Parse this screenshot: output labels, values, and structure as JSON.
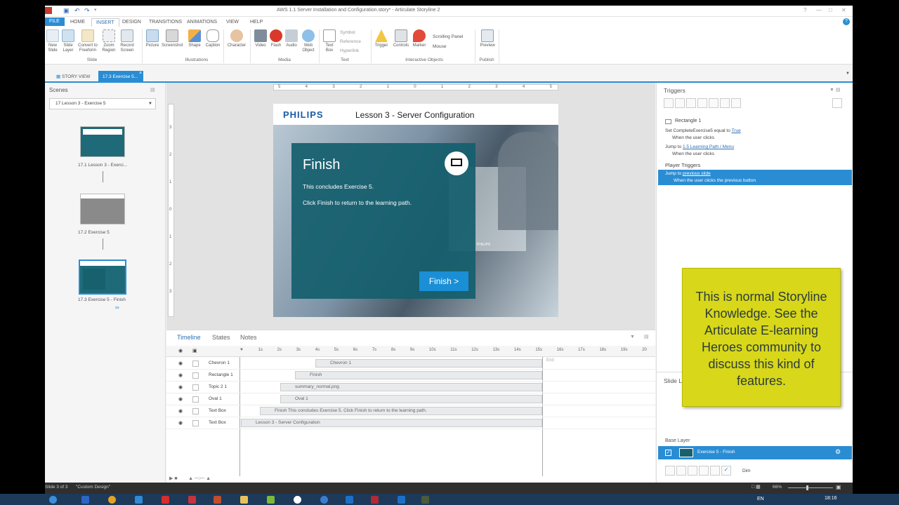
{
  "window": {
    "title": "AWS 1.1 Server Installation and Configuration.story* - Articulate Storyline 2"
  },
  "menu": [
    "FILE",
    "HOME",
    "INSERT",
    "DESIGN",
    "TRANSITIONS",
    "ANIMATIONS",
    "VIEW",
    "HELP"
  ],
  "ribbon": {
    "slide": {
      "group": "Slide",
      "buttons": [
        "New\nSlide",
        "Slide\nLayer",
        "Convert to\nFreeform",
        "Zoom\nRegion",
        "Record\nScreen"
      ]
    },
    "illustrations": {
      "group": "Illustrations",
      "buttons": [
        "Picture",
        "Screenshot",
        "Shape",
        "Caption"
      ]
    },
    "character": {
      "button": "Character"
    },
    "media": {
      "group": "Media",
      "buttons": [
        "Video",
        "Flash",
        "Audio",
        "Web\nObject"
      ]
    },
    "text": {
      "group": "Text",
      "buttons": [
        "Text\nBox"
      ],
      "small": [
        "Symbol",
        "Reference",
        "Hyperlink"
      ]
    },
    "interactive": {
      "group": "Interactive Objects",
      "buttons": [
        "Trigger",
        "Controls",
        "Marker"
      ],
      "small": [
        "Scrolling Panel",
        "Mouse"
      ]
    },
    "publish": {
      "group": "Publish",
      "buttons": [
        "Preview"
      ]
    }
  },
  "tabs": {
    "story_view": "STORY VIEW",
    "current": "17.3 Exercise 5..."
  },
  "scenes": {
    "title": "Scenes",
    "dropdown": "17 Lesson 3 - Exercise 5",
    "items": [
      {
        "label": "17.1 Lesson 3 - Exerci..."
      },
      {
        "label": "17.2 Exercise 5"
      },
      {
        "label": "17.3 Exercise 5 - Finish"
      }
    ]
  },
  "slide": {
    "brand": "PHILIPS",
    "header": "Lesson 3 - Server Configuration",
    "heading": "Finish",
    "line1": "This concludes Exercise 5.",
    "line2": "Click Finish to return to the learning path.",
    "button": "Finish  >",
    "monitor_brand": "PHILIPS"
  },
  "ruler": {
    "h": [
      "5",
      "4",
      "3",
      "2",
      "1",
      "0",
      "1",
      "2",
      "3",
      "4",
      "5"
    ],
    "v": [
      "3",
      "2",
      "1",
      "0",
      "1",
      "2",
      "3"
    ]
  },
  "timeline": {
    "tabs": [
      "Timeline",
      "States",
      "Notes"
    ],
    "ticks": [
      "1s",
      "2s",
      "3s",
      "4s",
      "5s",
      "6s",
      "7s",
      "8s",
      "9s",
      "10s",
      "11s",
      "12s",
      "13s",
      "14s",
      "15s",
      "16s",
      "17s",
      "18s",
      "19s",
      "20"
    ],
    "end_label": "End",
    "rows": [
      {
        "name": "Chevron 1",
        "bar": "Chevron 1"
      },
      {
        "name": "Rectangle 1",
        "bar": "Finish"
      },
      {
        "name": "Topic 2 1",
        "bar": "summary_normal.png"
      },
      {
        "name": "Oval 1",
        "bar": "Oval 1"
      },
      {
        "name": "Text Box",
        "bar": "Finish  This concludes Exercise 5.   Click Finish to return to the learning path."
      },
      {
        "name": "Text Box",
        "bar": "Lesson 3 - Server Configuration"
      }
    ]
  },
  "triggers": {
    "title": "Triggers",
    "object": "Rectangle 1",
    "t1": {
      "prefix": "Set CompleteExercise5 equal to",
      "link": "True",
      "cond": "When the user clicks"
    },
    "t2": {
      "prefix": "Jump to",
      "link": "1.5 Learning Path / Menu",
      "cond": "When the user clicks"
    },
    "player_title": "Player Triggers",
    "p1": {
      "prefix": "Jump to",
      "link": "previous slide",
      "cond": "When the user clicks the previous button"
    },
    "slide_layers": "Slide L",
    "base_layer": "Base Layer",
    "layer": "Exercise 5 - Finish",
    "dim": "Dim"
  },
  "status": {
    "slide": "Slide 3 of 3",
    "design": "\"Custom Design\"",
    "zoom": "66%"
  },
  "taskbar": {
    "lang": "EN",
    "time": "18:16"
  },
  "note": "This is normal Storyline Knowledge. See the Articulate E-learning Heroes community to discuss this kind of features."
}
